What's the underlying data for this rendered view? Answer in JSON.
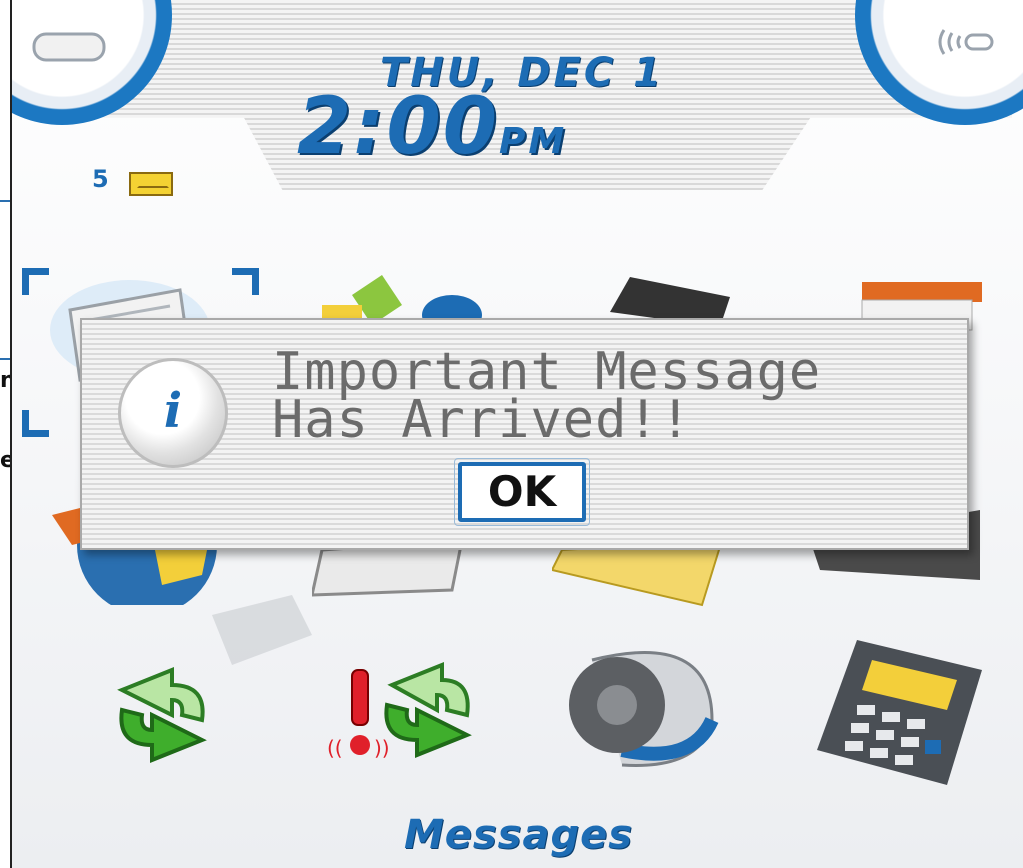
{
  "header": {
    "date": "THU, DEC 1",
    "time": "2:00",
    "ampm": "PM",
    "unread_count": "5"
  },
  "dialog": {
    "line1": "Important Message",
    "line2": "Has Arrived!!",
    "ok_label": "OK",
    "info_glyph": "i"
  },
  "caption": "Messages",
  "background_fragments": {
    "frag1": "n",
    "frag2": "e"
  },
  "icons": {
    "header_left": "battery-icon",
    "header_right": "signal-icon",
    "unread": "envelope-icon",
    "apps": [
      "messages-icon",
      "options-icon",
      "memopad-icon",
      "calendar-icon",
      "browser-icon",
      "address-book-icon",
      "tasks-icon",
      "phone-icon",
      "sync-icon",
      "alert-sync-icon",
      "profiles-icon",
      "calculator-icon"
    ]
  },
  "colors": {
    "accent": "#1d6cb4",
    "dialog_text": "#6b6b6b"
  }
}
